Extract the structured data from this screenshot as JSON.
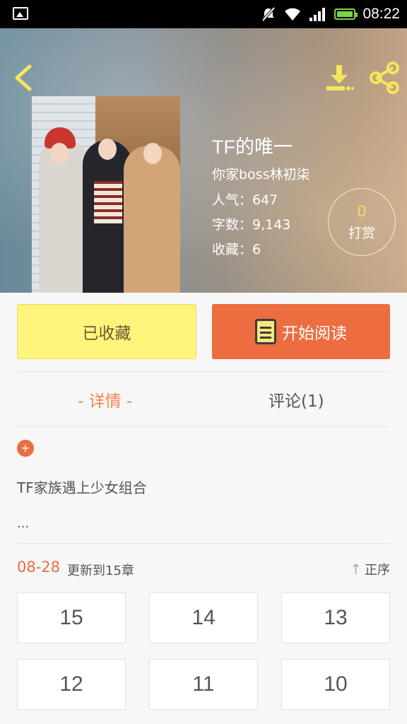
{
  "status_bar": {
    "time": "08:22"
  },
  "book": {
    "title": "TF的唯一",
    "author": "你家boss林初柒",
    "popularity": "人气：647",
    "words": "字数：9,143",
    "favorites": "收藏：6"
  },
  "reward": {
    "count": "0",
    "label": "打赏"
  },
  "actions": {
    "favorited_label": "已收藏",
    "start_reading_label": "开始阅读"
  },
  "tabs": [
    {
      "label": "- 详情 -"
    },
    {
      "label": "评论(1)"
    }
  ],
  "expand_label": "+",
  "description": "TF家族遇上少女组合",
  "description_more": "...",
  "update": {
    "date": "08-28",
    "text": "更新到15章",
    "sort_label": "正序"
  },
  "chapters": [
    "15",
    "14",
    "13",
    "12",
    "11",
    "10"
  ],
  "icons": [
    "gallery-icon",
    "mute-icon",
    "wifi-icon",
    "signal-icon",
    "battery-icon",
    "back-icon",
    "download-icon",
    "share-icon",
    "book-icon",
    "sort-up-icon"
  ],
  "colors": {
    "accent": "#ec6d3f",
    "favorited_bg": "#fff57c",
    "icon_yellow": "#f5e75a"
  }
}
